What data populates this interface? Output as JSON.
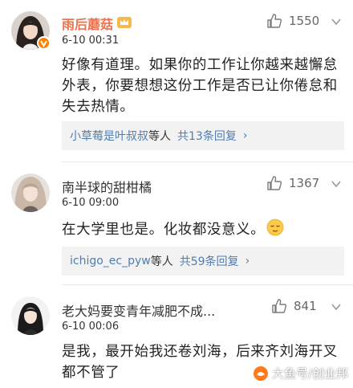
{
  "comments": [
    {
      "username": "雨后蘑菇",
      "time": "6-10 00:31",
      "likes": "1550",
      "text": "好像有道理。如果你的工作让你越来越懈怠外表，你要想想这份工作是否已让你倦怠和失去热情。",
      "reply": {
        "names": "小草莓是叶叔叔",
        "mid": "等人",
        "count": "共13条回复",
        "chevron": "›"
      }
    },
    {
      "username": "南半球的甜柑橘",
      "time": "6-10 09:00",
      "likes": "1367",
      "text": "在大学里也是。化妆都没意义。",
      "reply": {
        "names": "ichigo_ec_pyw",
        "mid": "等人",
        "count": "共59条回复",
        "chevron": "›"
      }
    },
    {
      "username": "老大妈要变青年减肥不成...",
      "time": "6-10 00:06",
      "likes": "841",
      "text": "是我，最开始我还卷刘海，后来齐刘海开叉都不管了"
    }
  ],
  "watermark": "大鱼号/创业邦",
  "icons": {
    "like": "thumbs-up-icon",
    "more": "chevron-down-icon",
    "vip": "vip-badge-icon",
    "crown": "crown-icon",
    "emoji": "relieved-face-icon"
  },
  "colors": {
    "username_vip": "#eb7350",
    "link": "#507daf",
    "reply_bg": "#f2f2f2"
  }
}
